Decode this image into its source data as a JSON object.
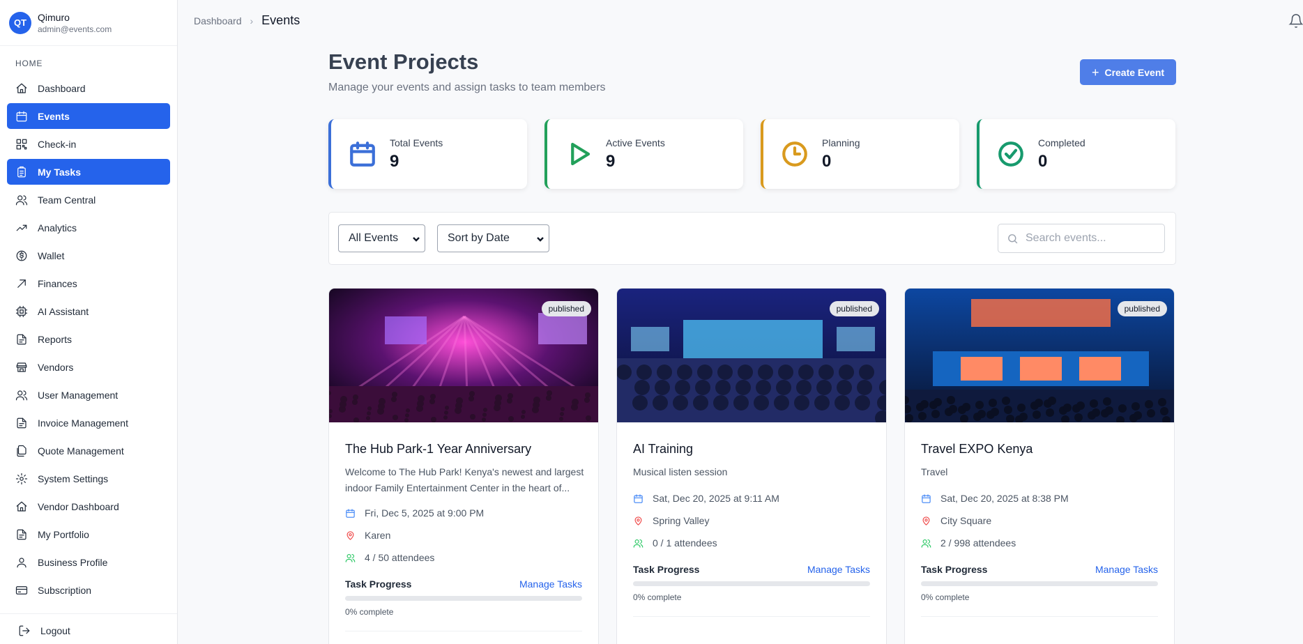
{
  "user": {
    "initials": "QT",
    "name": "Qimuro",
    "email": "admin@events.com"
  },
  "sidebar": {
    "section": "HOME",
    "items": [
      {
        "label": "Dashboard",
        "icon": "home-icon",
        "active": false
      },
      {
        "label": "Events",
        "icon": "calendar-icon",
        "active": true
      },
      {
        "label": "Check-in",
        "icon": "qr-code-icon",
        "active": false
      },
      {
        "label": "My Tasks",
        "icon": "clipboard-icon",
        "active": true
      },
      {
        "label": "Team Central",
        "icon": "users-icon",
        "active": false
      },
      {
        "label": "Analytics",
        "icon": "trending-up-icon",
        "active": false
      },
      {
        "label": "Wallet",
        "icon": "dollar-circle-icon",
        "active": false
      },
      {
        "label": "Finances",
        "icon": "arrow-up-right-icon",
        "active": false
      },
      {
        "label": "AI Assistant",
        "icon": "cpu-icon",
        "active": false
      },
      {
        "label": "Reports",
        "icon": "file-icon",
        "active": false
      },
      {
        "label": "Vendors",
        "icon": "store-icon",
        "active": false
      },
      {
        "label": "User Management",
        "icon": "users-icon",
        "active": false
      },
      {
        "label": "Invoice Management",
        "icon": "file-icon",
        "active": false
      },
      {
        "label": "Quote Management",
        "icon": "files-icon",
        "active": false
      },
      {
        "label": "System Settings",
        "icon": "gear-icon",
        "active": false
      },
      {
        "label": "Vendor Dashboard",
        "icon": "home-icon",
        "active": false
      },
      {
        "label": "My Portfolio",
        "icon": "file-icon",
        "active": false
      },
      {
        "label": "Business Profile",
        "icon": "user-icon",
        "active": false
      },
      {
        "label": "Subscription",
        "icon": "credit-card-icon",
        "active": false
      }
    ],
    "logout": "Logout"
  },
  "breadcrumb": {
    "root": "Dashboard",
    "current": "Events"
  },
  "header": {
    "title": "Event Projects",
    "subtitle": "Manage your events and assign tasks to team members",
    "create_button": "Create Event"
  },
  "stats": [
    {
      "label": "Total Events",
      "value": "9",
      "color": "#3b6fd8",
      "icon": "calendar-icon"
    },
    {
      "label": "Active Events",
      "value": "9",
      "color": "#22a05a",
      "icon": "play-icon"
    },
    {
      "label": "Planning",
      "value": "0",
      "color": "#d99a1e",
      "icon": "clock-icon"
    },
    {
      "label": "Completed",
      "value": "0",
      "color": "#179a6d",
      "icon": "check-circle-icon"
    }
  ],
  "filters": {
    "event_filter": "All Events",
    "sort": "Sort by Date",
    "search_placeholder": "Search events..."
  },
  "events": [
    {
      "title": "The Hub Park-1 Year Anniversary",
      "description": "Welcome to The Hub Park! Kenya's newest and largest indoor Family Entertainment Center in the heart of...",
      "status": "published",
      "date": "Fri, Dec 5, 2025 at 9:00 PM",
      "location": "Karen",
      "attendees": "4 / 50 attendees",
      "progress_label": "Task Progress",
      "manage_label": "Manage Tasks",
      "progress": 0,
      "progress_text": "0% complete"
    },
    {
      "title": "AI Training",
      "description": "Musical listen session",
      "status": "published",
      "date": "Sat, Dec 20, 2025 at 9:11 AM",
      "location": "Spring Valley",
      "attendees": "0 / 1 attendees",
      "progress_label": "Task Progress",
      "manage_label": "Manage Tasks",
      "progress": 0,
      "progress_text": "0% complete"
    },
    {
      "title": "Travel EXPO Kenya",
      "description": "Travel",
      "status": "published",
      "date": "Sat, Dec 20, 2025 at 8:38 PM",
      "location": "City Square",
      "attendees": "2 / 998 attendees",
      "progress_label": "Task Progress",
      "manage_label": "Manage Tasks",
      "progress": 0,
      "progress_text": "0% complete"
    }
  ]
}
